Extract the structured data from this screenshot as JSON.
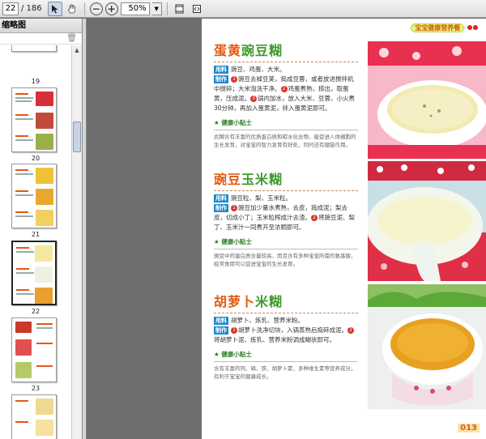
{
  "toolbar": {
    "current_page": "22",
    "page_total": "/ 186",
    "zoom": "50%"
  },
  "thumbnails": {
    "title": "缩略图",
    "labels": [
      "19",
      "20",
      "21",
      "22",
      "23"
    ]
  },
  "page": {
    "header": "宝宝健康营养餐",
    "page_number": "013",
    "recipes": [
      {
        "title_a": "蛋黄",
        "title_b": "豌豆糊",
        "ingredients_tag": "用料",
        "ingredients": "豌豆、鸡蛋、大米。",
        "method_tag": "制作",
        "steps": [
          "豌豆去掉豆荚，捣成豆蓉，或者放进搅拌机中搅碎；大米泡洗干净。",
          "鸡蛋煮熟，捞出，取蛋黄，压成泥。",
          "锅内加水，放入大米、豆蓉，小火煮30分钟，再加入蛋黄泥，拌入蛋黄泥即可。"
        ],
        "tips_title": "健康小贴士",
        "tips": "此糊含有丰富的优质蛋白质和碳水化合物，能促进人体细胞的生长发育，对宝宝的智力发育有好处，同时还有健脑作用。"
      },
      {
        "title_a": "豌豆",
        "title_b": "玉米糊",
        "ingredients_tag": "用料",
        "ingredients": "豌豆粒、梨、玉米粒。",
        "method_tag": "制作",
        "steps": [
          "豌豆加少量水煮熟，去皮，捣成泥；梨去皮，切成小丁；玉米粒榨成汁去渣。",
          "将豌豆泥、梨丁、玉米汁一同煮开至浓稠即可。"
        ],
        "tips_title": "健康小贴士",
        "tips": "豌豆中的蛋白质含量较高，而且含有多种宝宝所需的氨基酸，经常食用可以促进宝宝的生长发育。"
      },
      {
        "title_a": "胡萝卜",
        "title_b": "米糊",
        "ingredients_tag": "用料",
        "ingredients": "胡萝卜、炼乳、营养米粉。",
        "method_tag": "制作",
        "steps": [
          "胡萝卜洗净切块，入锅蒸熟后捣碎成泥。",
          "将胡萝卜泥、炼乳、营养米粉调成糊状即可。"
        ],
        "tips_title": "健康小贴士",
        "tips": "含有丰富的钙、磷、铁、胡萝卜素、多种维生素等营养成分，有利于宝宝的健康成长。"
      }
    ]
  },
  "colors": {
    "accent_orange": "#e35a10",
    "accent_green": "#3f9a2c",
    "tag_blue": "#1d87c9",
    "step_red": "#d9342b"
  },
  "icons": [
    "select-arrow-icon",
    "hand-tool-icon",
    "zoom-out-icon",
    "zoom-in-icon",
    "dropdown-chevron-icon",
    "fit-page-icon",
    "fit-width-icon",
    "trash-icon"
  ]
}
